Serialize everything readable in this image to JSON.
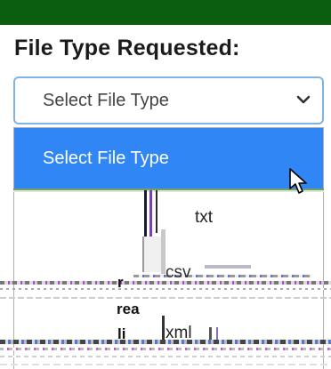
{
  "form": {
    "heading": "File Type Requested:",
    "select": {
      "value": "Select File Type"
    },
    "dropdown": {
      "highlighted": "Select File Type",
      "options": [
        "txt",
        "csv",
        "xml"
      ]
    },
    "fragments": [
      "r",
      "rea",
      "li"
    ]
  },
  "colors": {
    "topbar": "#0b5e10",
    "highlight": "#2f86f4",
    "focus_border": "#7fb2e6"
  },
  "icons": {
    "select_arrow": "chevron-down-icon",
    "pointer": "mouse-cursor-icon"
  }
}
